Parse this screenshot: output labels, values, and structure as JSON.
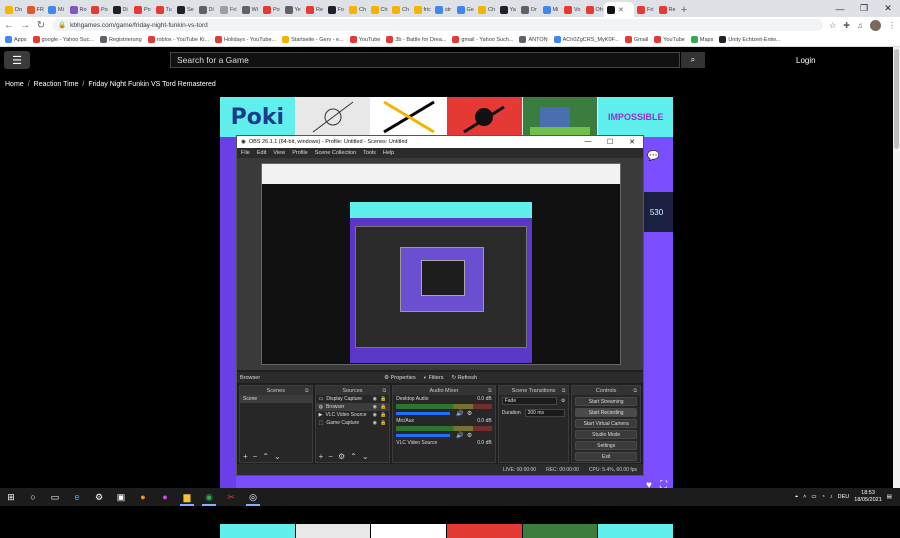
{
  "browser": {
    "tabs": [
      {
        "label": "Do",
        "color": "#f4b400"
      },
      {
        "label": "FR",
        "color": "#e4572e"
      },
      {
        "label": "Mi",
        "color": "#4285f4"
      },
      {
        "label": "Ro",
        "color": "#7e57c2"
      },
      {
        "label": "Po",
        "color": "#e53935"
      },
      {
        "label": "Di",
        "color": "#202124"
      },
      {
        "label": "Po",
        "color": "#e53935"
      },
      {
        "label": "Tu",
        "color": "#e53935"
      },
      {
        "label": "Se",
        "color": "#202124"
      },
      {
        "label": "Di",
        "color": "#5f6368"
      },
      {
        "label": "Fri",
        "color": "#9e9e9e"
      },
      {
        "label": "Wi",
        "color": "#5f6368"
      },
      {
        "label": "Po",
        "color": "#e53935"
      },
      {
        "label": "Ye",
        "color": "#5f6368"
      },
      {
        "label": "Re",
        "color": "#e53935"
      },
      {
        "label": "Fo",
        "color": "#202124"
      },
      {
        "label": "Ch",
        "color": "#f4b400"
      },
      {
        "label": "Ch",
        "color": "#f4b400"
      },
      {
        "label": "Ch",
        "color": "#f4b400"
      },
      {
        "label": "fric",
        "color": "#f4b400"
      },
      {
        "label": "str",
        "color": "#4285f4"
      },
      {
        "label": "Ge",
        "color": "#4285f4"
      },
      {
        "label": "Ch",
        "color": "#f4b400"
      },
      {
        "label": "Ya",
        "color": "#202124"
      },
      {
        "label": "Dr",
        "color": "#5f6368"
      },
      {
        "label": "Mi",
        "color": "#4285f4"
      },
      {
        "label": "Vo",
        "color": "#e53935"
      },
      {
        "label": "Oh",
        "color": "#e53935"
      },
      {
        "label": "Fri",
        "color": "#e53935"
      },
      {
        "label": "Re",
        "color": "#e53935"
      }
    ],
    "active_tab_label": "",
    "url": "kbhgames.com/game/friday-night-funkin-vs-tord",
    "bookmarks": [
      {
        "label": "Apps",
        "color": "#4285f4"
      },
      {
        "label": "google - Yahoo Suc...",
        "color": "#e53935"
      },
      {
        "label": "Registrierung",
        "color": "#5f6368"
      },
      {
        "label": "roblox - YouTube Ki...",
        "color": "#e53935"
      },
      {
        "label": "Holidays - YouTube...",
        "color": "#e53935"
      },
      {
        "label": "Startseite - Gerv - e...",
        "color": "#f4b400"
      },
      {
        "label": "YouTube",
        "color": "#e53935"
      },
      {
        "label": "3b - Battle for Drea...",
        "color": "#e53935"
      },
      {
        "label": "gmail - Yahoo Such...",
        "color": "#e53935"
      },
      {
        "label": "ANTON",
        "color": "#5f6368"
      },
      {
        "label": "ACh0ZgCRS_MyK0F...",
        "color": "#4285f4"
      },
      {
        "label": "Gmail",
        "color": "#e53935"
      },
      {
        "label": "YouTube",
        "color": "#e53935"
      },
      {
        "label": "Maps",
        "color": "#34a853"
      },
      {
        "label": "Unity Echtzeit-Entw...",
        "color": "#202124"
      }
    ]
  },
  "site": {
    "search_placeholder": "Search for a Game",
    "login": "Login",
    "crumbs": [
      "Home",
      "Reaction Time",
      "Friday Night Funkin VS Tord Remastered"
    ],
    "poki_logo": "Poki",
    "impossible_label": "IMPOSSIBLE",
    "score_text": "530"
  },
  "obs": {
    "title": "OBS 26.1.1 (64-bit, windows) - Profile: Untitled - Scenes: Untitled",
    "menu": [
      "File",
      "Edit",
      "View",
      "Profile",
      "Scene Collection",
      "Tools",
      "Help"
    ],
    "bar": {
      "source": "Browser",
      "properties": "Properties",
      "filters": "Filters",
      "refresh": "Refresh"
    },
    "docks": {
      "scenes": "Scenes",
      "sources": "Sources",
      "mixer": "Audio Mixer",
      "transitions": "Scene Transitions",
      "controls": "Controls"
    },
    "scenes": [
      "Scene"
    ],
    "sources": [
      "Display Capture",
      "Browser",
      "VLC Video Source",
      "Game Capture"
    ],
    "mixer": [
      {
        "name": "Desktop Audio",
        "db": "0.0 dB"
      },
      {
        "name": "Mic/Aux",
        "db": "0.0 dB"
      },
      {
        "name": "VLC Video Source",
        "db": "0.0 dB"
      }
    ],
    "transition": {
      "type": "Fade",
      "duration_label": "Duration",
      "duration": "300 ms"
    },
    "controls": [
      "Start Streaming",
      "Start Recording",
      "Start Virtual Camera",
      "Studio Mode",
      "Settings",
      "Exit"
    ],
    "status": {
      "live": "LIVE: 00:00:00",
      "rec": "REC: 00:00:00",
      "cpu": "CPU: 5.4%, 60.00 fps"
    }
  },
  "taskbar": {
    "lang": "DEU",
    "time": "18:53",
    "date": "18/05/2021"
  }
}
